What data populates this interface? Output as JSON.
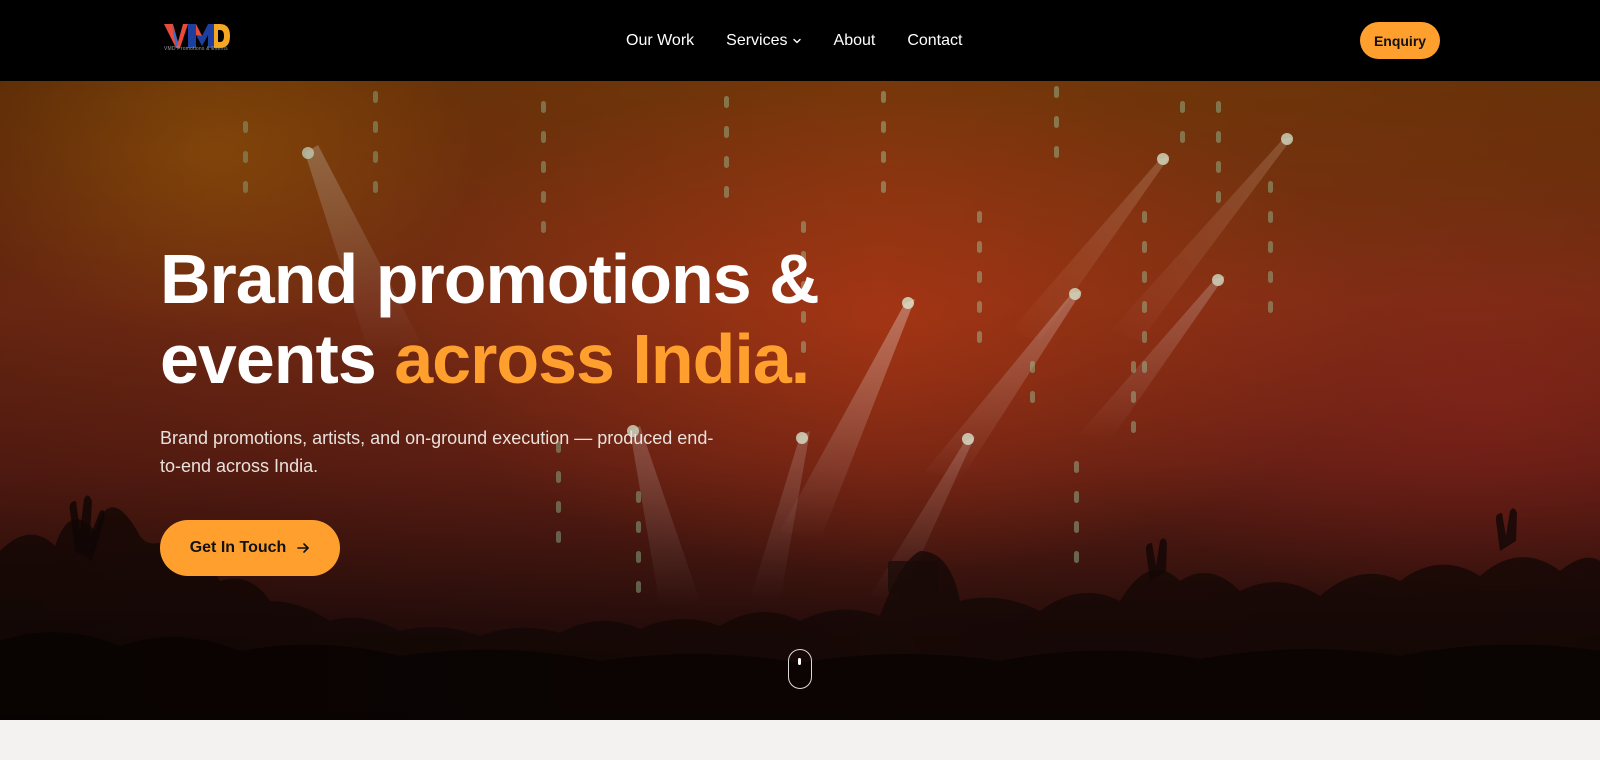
{
  "brand": {
    "logo_text": "VMD",
    "logo_caption": "VMD Promotions & Events"
  },
  "nav": {
    "items": [
      {
        "label": "Our Work"
      },
      {
        "label": "Services"
      },
      {
        "label": "About"
      },
      {
        "label": "Contact"
      }
    ],
    "enquiry_label": "Enquiry"
  },
  "hero": {
    "title_line1": "Brand promotions &",
    "title_line2_prefix": "events ",
    "title_line2_accent": "across India.",
    "subtitle": "Brand promotions, artists, and on-ground execution — produced end-to-end across India.",
    "cta_label": "Get In Touch"
  },
  "icons": {
    "services_chevron": "chevron-down-icon",
    "cta_arrow": "arrow-right-icon",
    "scroll": "scroll-mouse-icon"
  },
  "colors": {
    "accent": "#ffa02e",
    "nav_bg": "#000000",
    "page_bg": "#f3f2f0"
  }
}
